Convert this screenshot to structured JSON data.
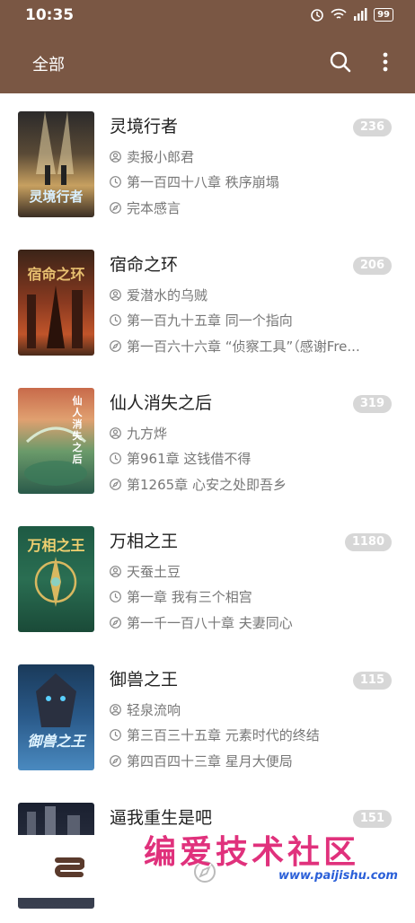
{
  "status": {
    "time": "10:35",
    "battery": "99"
  },
  "appbar": {
    "title": "全部"
  },
  "books": [
    {
      "title": "灵境行者",
      "count": "236",
      "author": "卖报小郎君",
      "latest": "第一百四十八章 秩序崩塌",
      "read": "完本感言",
      "cover_text": "灵境行者"
    },
    {
      "title": "宿命之环",
      "count": "206",
      "author": "爱潜水的乌贼",
      "latest": "第一百九十五章 同一个指向",
      "read": "第一百六十六章 “侦察工具”（感谢Fre...",
      "cover_text": "宿命之环"
    },
    {
      "title": "仙人消失之后",
      "count": "319",
      "author": "九方烨",
      "latest": "第961章 这钱借不得",
      "read": "第1265章 心安之处即吾乡",
      "cover_text": "仙人消失之后"
    },
    {
      "title": "万相之王",
      "count": "1180",
      "author": "天蚕土豆",
      "latest": "第一章 我有三个相宫",
      "read": "第一千一百八十章 夫妻同心",
      "cover_text": "万相之王"
    },
    {
      "title": "御兽之王",
      "count": "115",
      "author": "轻泉流响",
      "latest": "第三百三十五章 元素时代的终结",
      "read": "第四百四十三章 星月大便局",
      "cover_text": "御兽之王"
    },
    {
      "title": "逼我重生是吧",
      "count": "151",
      "author": "",
      "latest": "",
      "read": "",
      "cover_text": ""
    }
  ],
  "watermark": {
    "main": "编爱技术社区",
    "url": "www.paijishu.com"
  }
}
